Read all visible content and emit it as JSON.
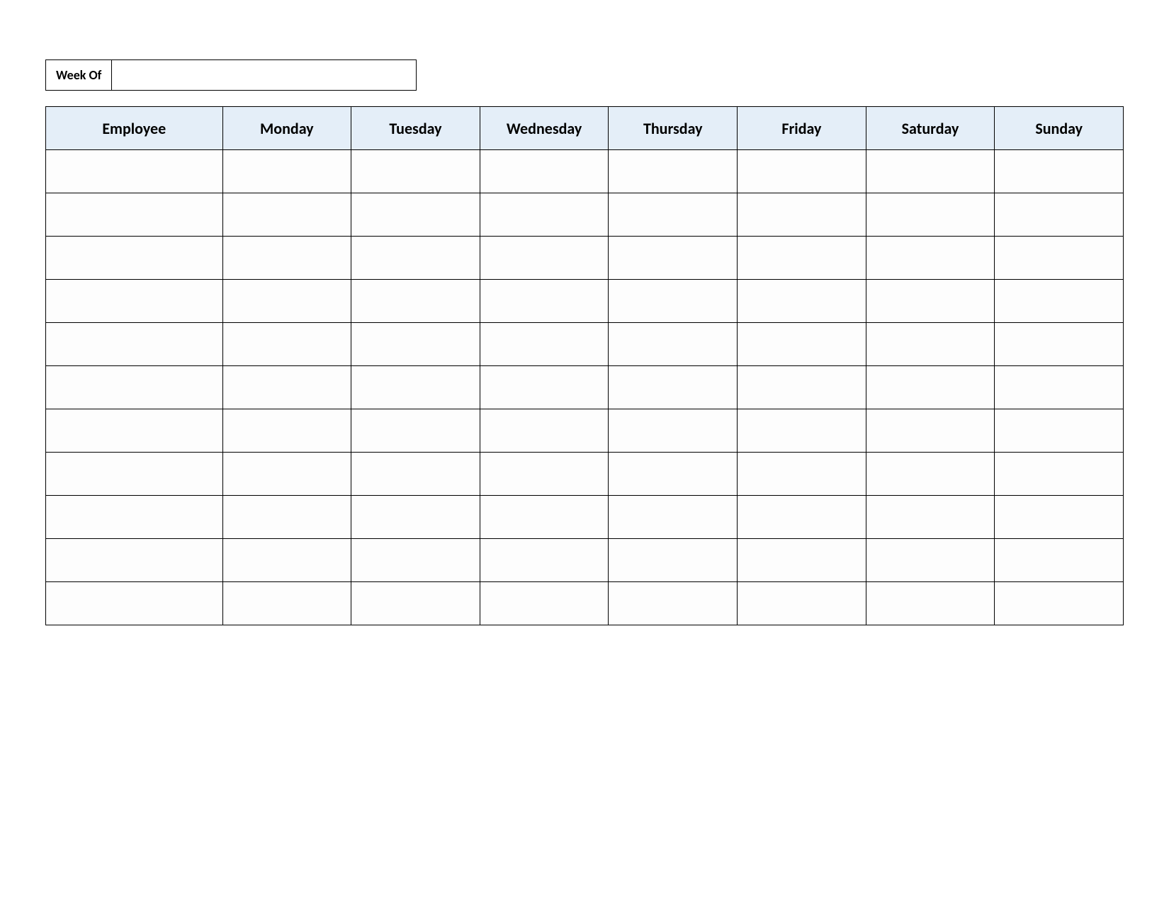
{
  "week_of": {
    "label": "Week Of",
    "value": ""
  },
  "table": {
    "headers": [
      "Employee",
      "Monday",
      "Tuesday",
      "Wednesday",
      "Thursday",
      "Friday",
      "Saturday",
      "Sunday"
    ],
    "rows": [
      [
        "",
        "",
        "",
        "",
        "",
        "",
        "",
        ""
      ],
      [
        "",
        "",
        "",
        "",
        "",
        "",
        "",
        ""
      ],
      [
        "",
        "",
        "",
        "",
        "",
        "",
        "",
        ""
      ],
      [
        "",
        "",
        "",
        "",
        "",
        "",
        "",
        ""
      ],
      [
        "",
        "",
        "",
        "",
        "",
        "",
        "",
        ""
      ],
      [
        "",
        "",
        "",
        "",
        "",
        "",
        "",
        ""
      ],
      [
        "",
        "",
        "",
        "",
        "",
        "",
        "",
        ""
      ],
      [
        "",
        "",
        "",
        "",
        "",
        "",
        "",
        ""
      ],
      [
        "",
        "",
        "",
        "",
        "",
        "",
        "",
        ""
      ],
      [
        "",
        "",
        "",
        "",
        "",
        "",
        "",
        ""
      ],
      [
        "",
        "",
        "",
        "",
        "",
        "",
        "",
        ""
      ]
    ]
  },
  "colors": {
    "header_bg": "#e4eef8",
    "border": "#000000"
  }
}
